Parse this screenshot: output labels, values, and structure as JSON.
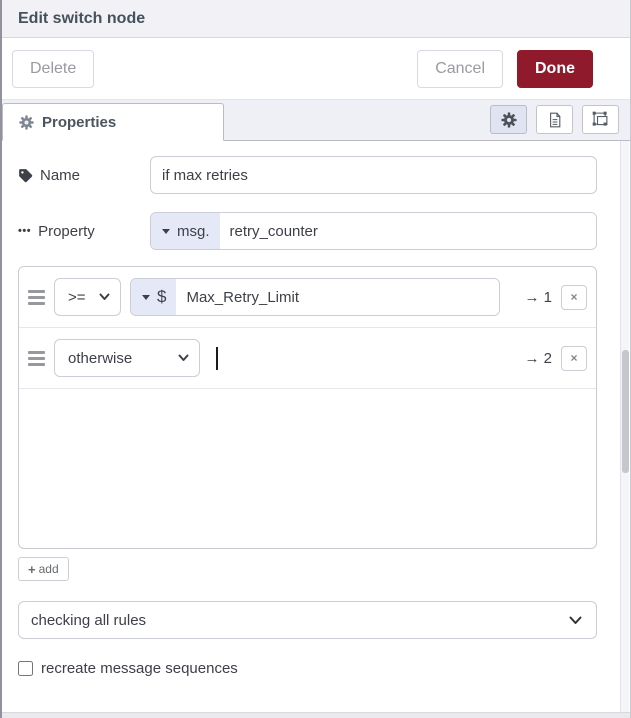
{
  "dialog": {
    "title": "Edit switch node"
  },
  "toolbar": {
    "delete_label": "Delete",
    "cancel_label": "Cancel",
    "done_label": "Done"
  },
  "tabs": {
    "properties_label": "Properties"
  },
  "form": {
    "name": {
      "label": "Name",
      "value": "if max retries"
    },
    "property": {
      "label": "Property",
      "prefix": "msg.",
      "value": "retry_counter"
    }
  },
  "rules": [
    {
      "operator": ">=",
      "value_type": "$",
      "value": "Max_Retry_Limit",
      "output": "1"
    },
    {
      "operator": "otherwise",
      "value": "",
      "output": "2"
    }
  ],
  "footer": {
    "add_label": "add",
    "mode_select_value": "checking all rules",
    "checkbox_label": "recreate message sequences",
    "checkbox_checked": false
  },
  "icons": {
    "arrow": "→",
    "remove": "×",
    "plus": "+",
    "ellipsis": "•••"
  },
  "colors": {
    "done_button": "#8f1a2c",
    "type_prefix_bg": "#e5e8f6",
    "selected_icon_button_bg": "#e0e3f1",
    "header_bg": "#f1f1f6"
  }
}
